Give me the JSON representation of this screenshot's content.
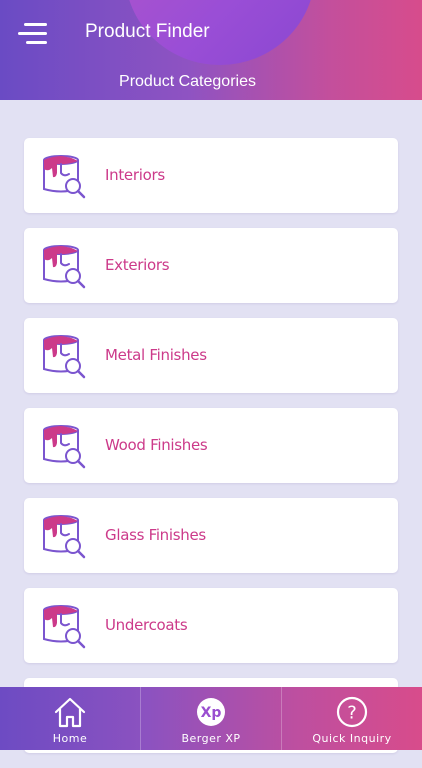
{
  "header": {
    "title": "Product Finder",
    "subtitle": "Product Categories",
    "menu_icon": "hamburger-menu-icon"
  },
  "categories": [
    {
      "label": "Interiors",
      "icon": "paint-bucket-search-icon"
    },
    {
      "label": "Exteriors",
      "icon": "paint-bucket-search-icon"
    },
    {
      "label": "Metal Finishes",
      "icon": "paint-bucket-search-icon"
    },
    {
      "label": "Wood Finishes",
      "icon": "paint-bucket-search-icon"
    },
    {
      "label": "Glass Finishes",
      "icon": "paint-bucket-search-icon"
    },
    {
      "label": "Undercoats",
      "icon": "paint-bucket-search-icon"
    }
  ],
  "tabbar": {
    "items": [
      {
        "label": "Home",
        "icon": "home-icon"
      },
      {
        "label": "Berger XP",
        "icon": "xp-logo-icon",
        "icon_text": "Xp"
      },
      {
        "label": "Quick Inquiry",
        "icon": "question-mark-icon",
        "icon_text": "?"
      }
    ]
  },
  "colors": {
    "accent_pink": "#cc3a8a",
    "accent_purple": "#6a4bc4",
    "background": "#e2e1f3"
  }
}
